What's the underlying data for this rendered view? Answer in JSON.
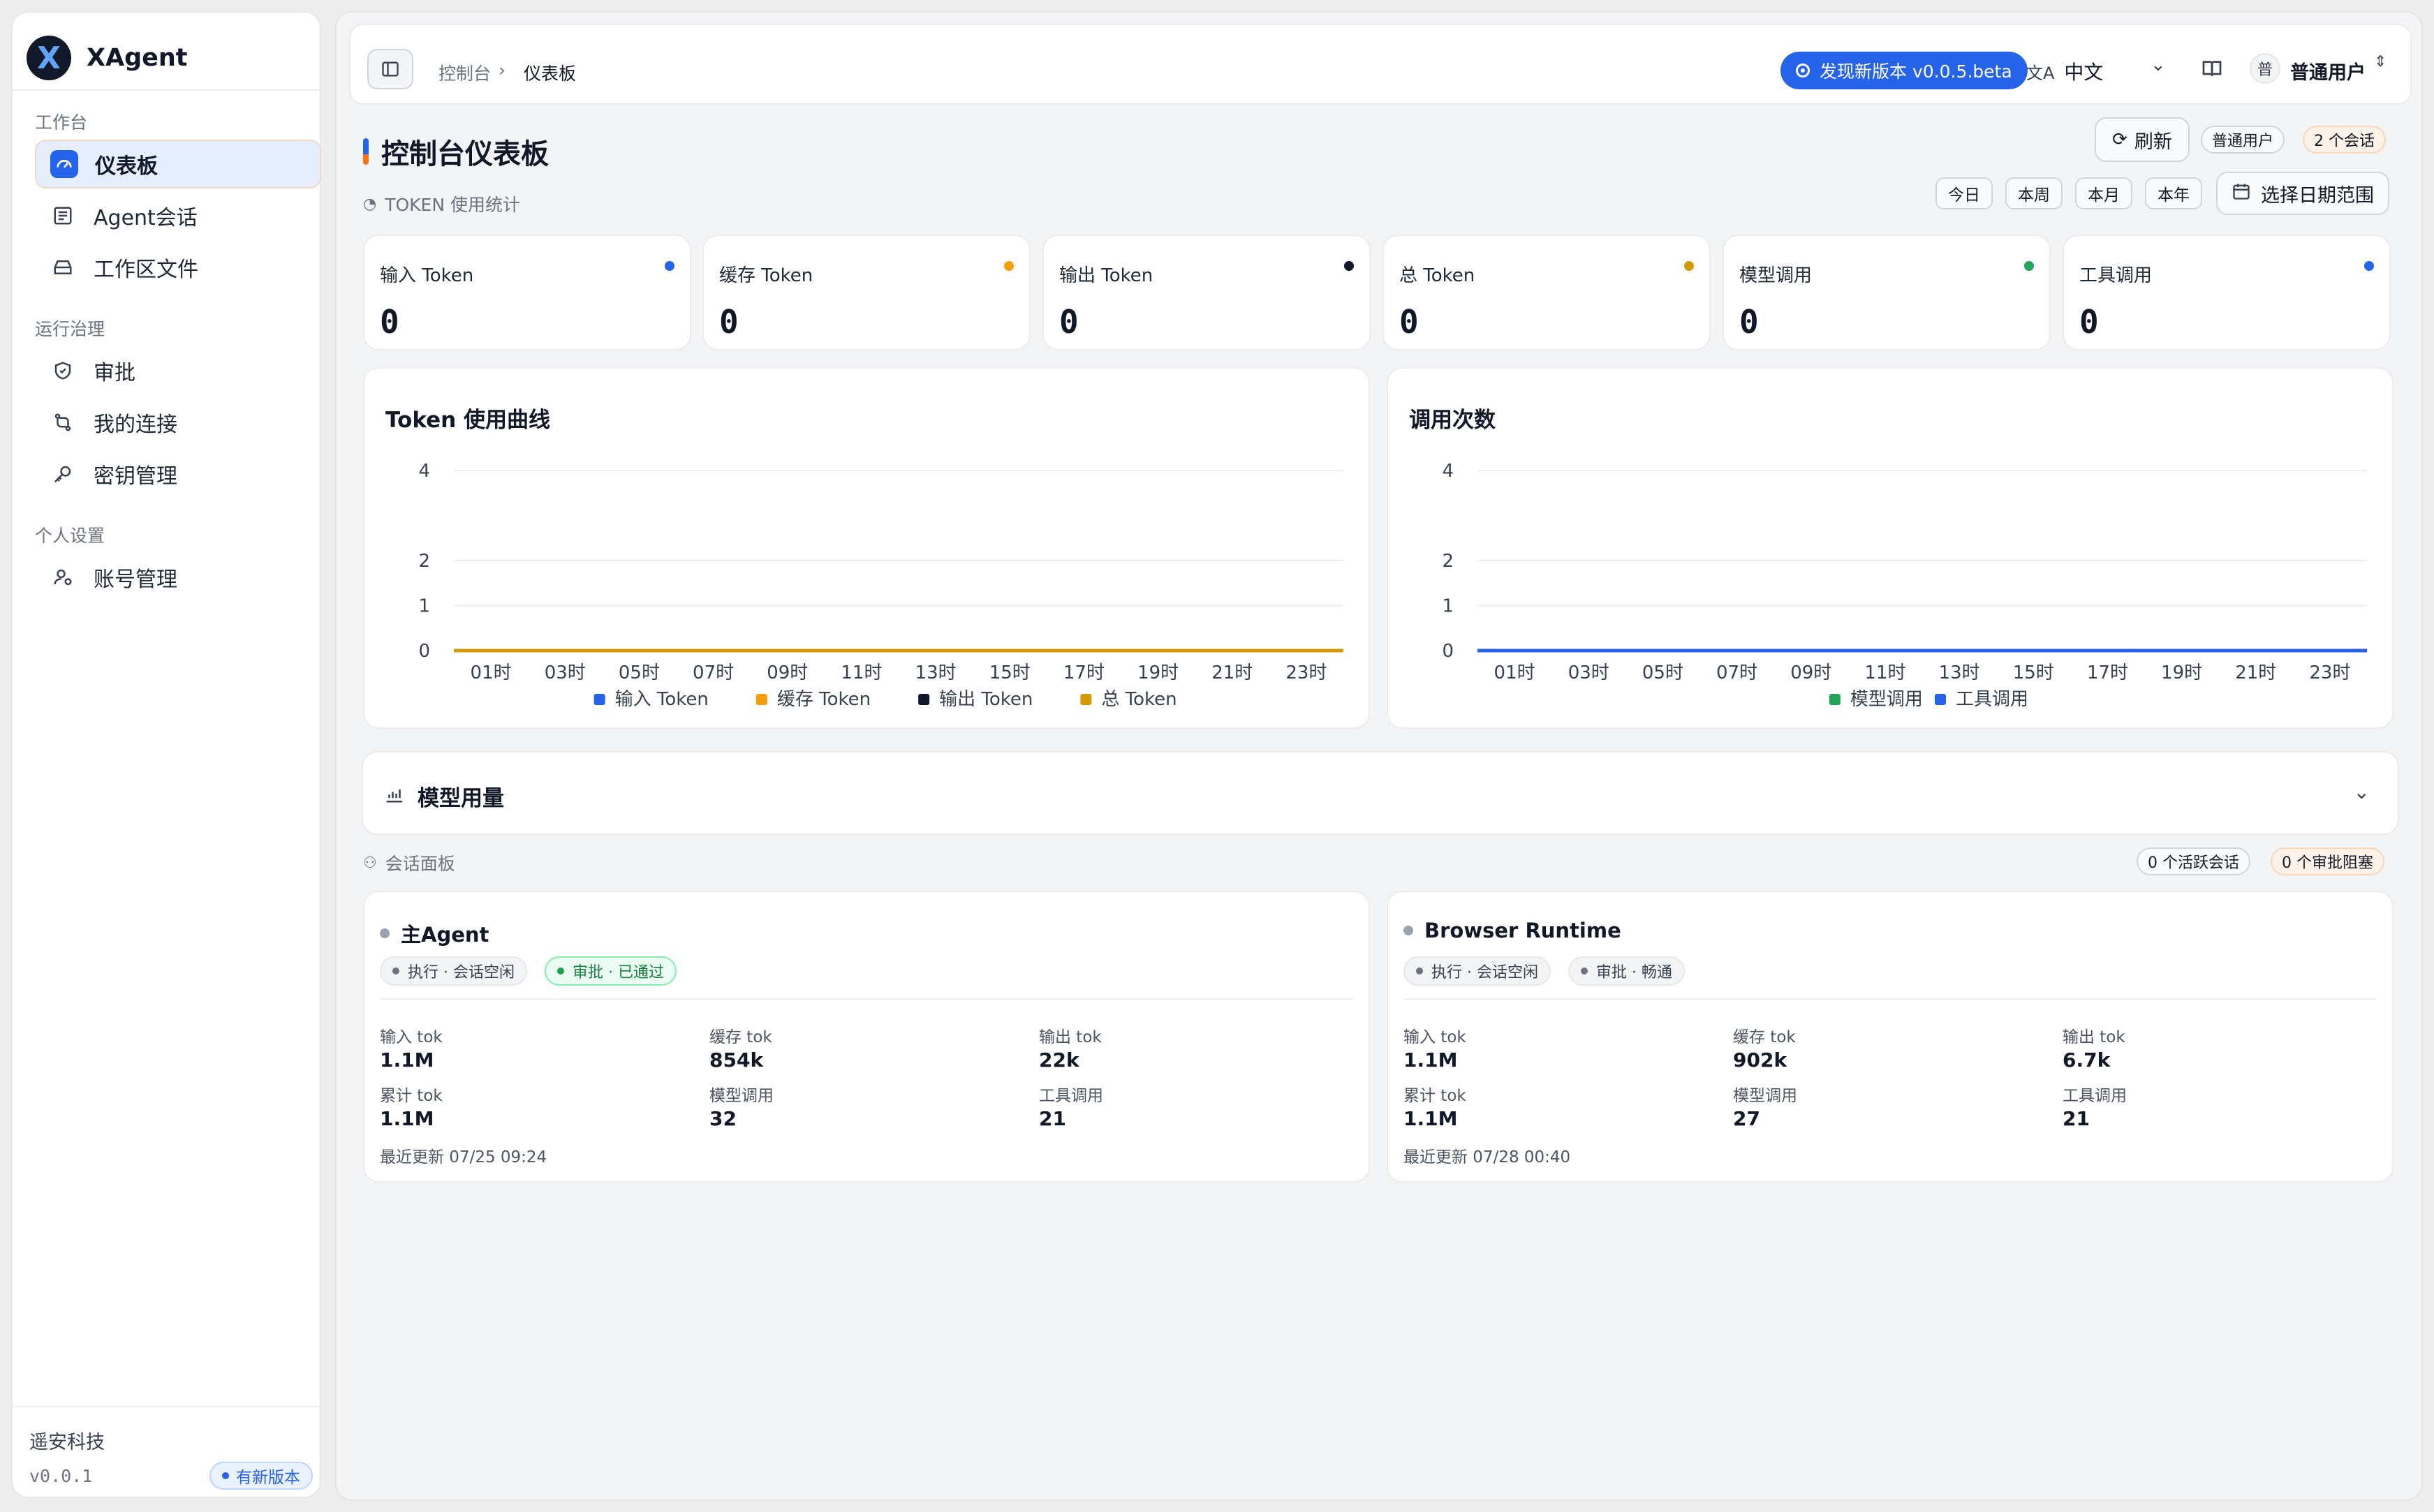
{
  "app": {
    "name": "XAgent",
    "logo_letter": "X"
  },
  "sidebar": {
    "groups": [
      {
        "label": "工作台",
        "items": [
          {
            "label": "仪表板",
            "icon": "gauge-icon",
            "active": true
          },
          {
            "label": "Agent会话",
            "icon": "message-list-icon"
          },
          {
            "label": "工作区文件",
            "icon": "drive-icon"
          }
        ]
      },
      {
        "label": "运行治理",
        "items": [
          {
            "label": "审批",
            "icon": "shield-check-icon"
          },
          {
            "label": "我的连接",
            "icon": "connection-icon"
          },
          {
            "label": "密钥管理",
            "icon": "key-icon"
          }
        ]
      },
      {
        "label": "个人设置",
        "items": [
          {
            "label": "账号管理",
            "icon": "user-cog-icon"
          }
        ]
      }
    ],
    "footer": {
      "company": "遥安科技",
      "version": "v0.0.1",
      "badge": "有新版本"
    }
  },
  "topbar": {
    "breadcrumb": [
      "控制台",
      "仪表板"
    ],
    "breadcrumb_sep": "›",
    "update_pill": "发现新版本 v0.0.5.beta",
    "language": "中文",
    "user_avatar": "普",
    "user_name": "普通用户"
  },
  "page": {
    "title": "控制台仪表板",
    "refresh": "刷新",
    "role_pill": "普通用户",
    "session_pill": "2 个会话",
    "token_section": "TOKEN 使用统计",
    "ranges": [
      "今日",
      "本周",
      "本月",
      "本年"
    ],
    "custom_range": "选择日期范围"
  },
  "stats": [
    {
      "label": "输入 Token",
      "value": "0",
      "color": "#2563eb"
    },
    {
      "label": "缓存 Token",
      "value": "0",
      "color": "#f59e0b"
    },
    {
      "label": "输出 Token",
      "value": "0",
      "color": "#111827"
    },
    {
      "label": "总 Token",
      "value": "0",
      "color": "#d49a06"
    },
    {
      "label": "模型调用",
      "value": "0",
      "color": "#22a559"
    },
    {
      "label": "工具调用",
      "value": "0",
      "color": "#2563eb"
    }
  ],
  "chart_data": [
    {
      "type": "line",
      "title": "Token 使用曲线",
      "x": [
        "01时",
        "03时",
        "05时",
        "07时",
        "09时",
        "11时",
        "13时",
        "15时",
        "17时",
        "19时",
        "21时",
        "23时"
      ],
      "yticks": [
        0,
        1,
        2,
        4
      ],
      "ylim": [
        0,
        4
      ],
      "series": [
        {
          "name": "输入 Token",
          "color": "#2563eb",
          "values": [
            0,
            0,
            0,
            0,
            0,
            0,
            0,
            0,
            0,
            0,
            0,
            0
          ]
        },
        {
          "name": "缓存 Token",
          "color": "#f59e0b",
          "values": [
            0,
            0,
            0,
            0,
            0,
            0,
            0,
            0,
            0,
            0,
            0,
            0
          ]
        },
        {
          "name": "输出 Token",
          "color": "#111827",
          "values": [
            0,
            0,
            0,
            0,
            0,
            0,
            0,
            0,
            0,
            0,
            0,
            0
          ]
        },
        {
          "name": "总 Token",
          "color": "#d49a06",
          "values": [
            0,
            0,
            0,
            0,
            0,
            0,
            0,
            0,
            0,
            0,
            0,
            0
          ]
        }
      ],
      "legend": "bottom",
      "grid": true
    },
    {
      "type": "line",
      "title": "调用次数",
      "x": [
        "01时",
        "03时",
        "05时",
        "07时",
        "09时",
        "11时",
        "13时",
        "15时",
        "17时",
        "19时",
        "21时",
        "23时"
      ],
      "yticks": [
        0,
        1,
        2,
        4
      ],
      "ylim": [
        0,
        4
      ],
      "series": [
        {
          "name": "模型调用",
          "color": "#22a559",
          "values": [
            0,
            0,
            0,
            0,
            0,
            0,
            0,
            0,
            0,
            0,
            0,
            0
          ]
        },
        {
          "name": "工具调用",
          "color": "#2563eb",
          "values": [
            0,
            0,
            0,
            0,
            0,
            0,
            0,
            0,
            0,
            0,
            0,
            0
          ]
        }
      ],
      "legend": "bottom",
      "grid": true
    }
  ],
  "model_usage": {
    "title": "模型用量"
  },
  "session_panel": {
    "label": "会话面板",
    "active_pill": "0 个活跃会话",
    "blocked_pill": "0 个审批阻塞",
    "sessions": [
      {
        "name": "主Agent",
        "tags": [
          {
            "text": "执行 · 会话空闲",
            "ok": false
          },
          {
            "text": "审批 · 已通过",
            "ok": true
          }
        ],
        "metrics": [
          {
            "label": "输入 tok",
            "value": "1.1M"
          },
          {
            "label": "缓存 tok",
            "value": "854k"
          },
          {
            "label": "输出 tok",
            "value": "22k"
          },
          {
            "label": "累计 tok",
            "value": "1.1M"
          },
          {
            "label": "模型调用",
            "value": "32"
          },
          {
            "label": "工具调用",
            "value": "21"
          }
        ],
        "updated": "最近更新 07/25 09:24"
      },
      {
        "name": "Browser Runtime",
        "tags": [
          {
            "text": "执行 · 会话空闲",
            "ok": false
          },
          {
            "text": "审批 · 畅通",
            "ok": false
          }
        ],
        "metrics": [
          {
            "label": "输入 tok",
            "value": "1.1M"
          },
          {
            "label": "缓存 tok",
            "value": "902k"
          },
          {
            "label": "输出 tok",
            "value": "6.7k"
          },
          {
            "label": "累计 tok",
            "value": "1.1M"
          },
          {
            "label": "模型调用",
            "value": "27"
          },
          {
            "label": "工具调用",
            "value": "21"
          }
        ],
        "updated": "最近更新 07/28 00:40"
      }
    ]
  }
}
